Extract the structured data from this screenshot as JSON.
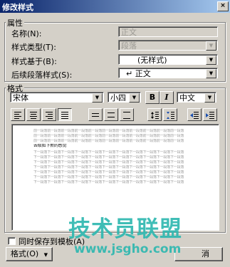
{
  "window": {
    "title": "修改样式",
    "close": "×"
  },
  "properties": {
    "legend": "属性",
    "name_label": "名称(N):",
    "name_value": "正文",
    "style_type_label": "样式类型(T):",
    "style_type_value": "段落",
    "based_on_label": "样式基于(B):",
    "based_on_value": "(无样式)",
    "following_label": "后续段落样式(S):",
    "following_value": "↵ 正文"
  },
  "format": {
    "legend": "格式",
    "font": "宋体",
    "size": "小四",
    "bold": "B",
    "italic": "I",
    "lang": "中文"
  },
  "preview": {
    "gray_text": "前一段落前一段落前一段落前一段落前一段落前一段落前一段落前一段落前一段落前一段落前一段落",
    "sample_text": "示例文字 示例文字 示例文字 示例文字 示例文字 示例文字 示例文字 示例文字 示例文字",
    "next_text": "下一段落下一段落下一段落下一段落下一段落下一段落下一段落下一段落下一段落下一段落下一段落",
    "heading_line": "去取如下新的感觉"
  },
  "bottom": {
    "save_template": "同时保存到模板(A)",
    "format_button": "格式(O)",
    "cancel_button": "消"
  },
  "watermark": {
    "line1": "技术员联盟",
    "line2": "www.jsgho.com"
  },
  "colors": {
    "titlebar": "#0a246a",
    "dialog": "#d4d0c8",
    "watermark": "#2fb8b0"
  }
}
